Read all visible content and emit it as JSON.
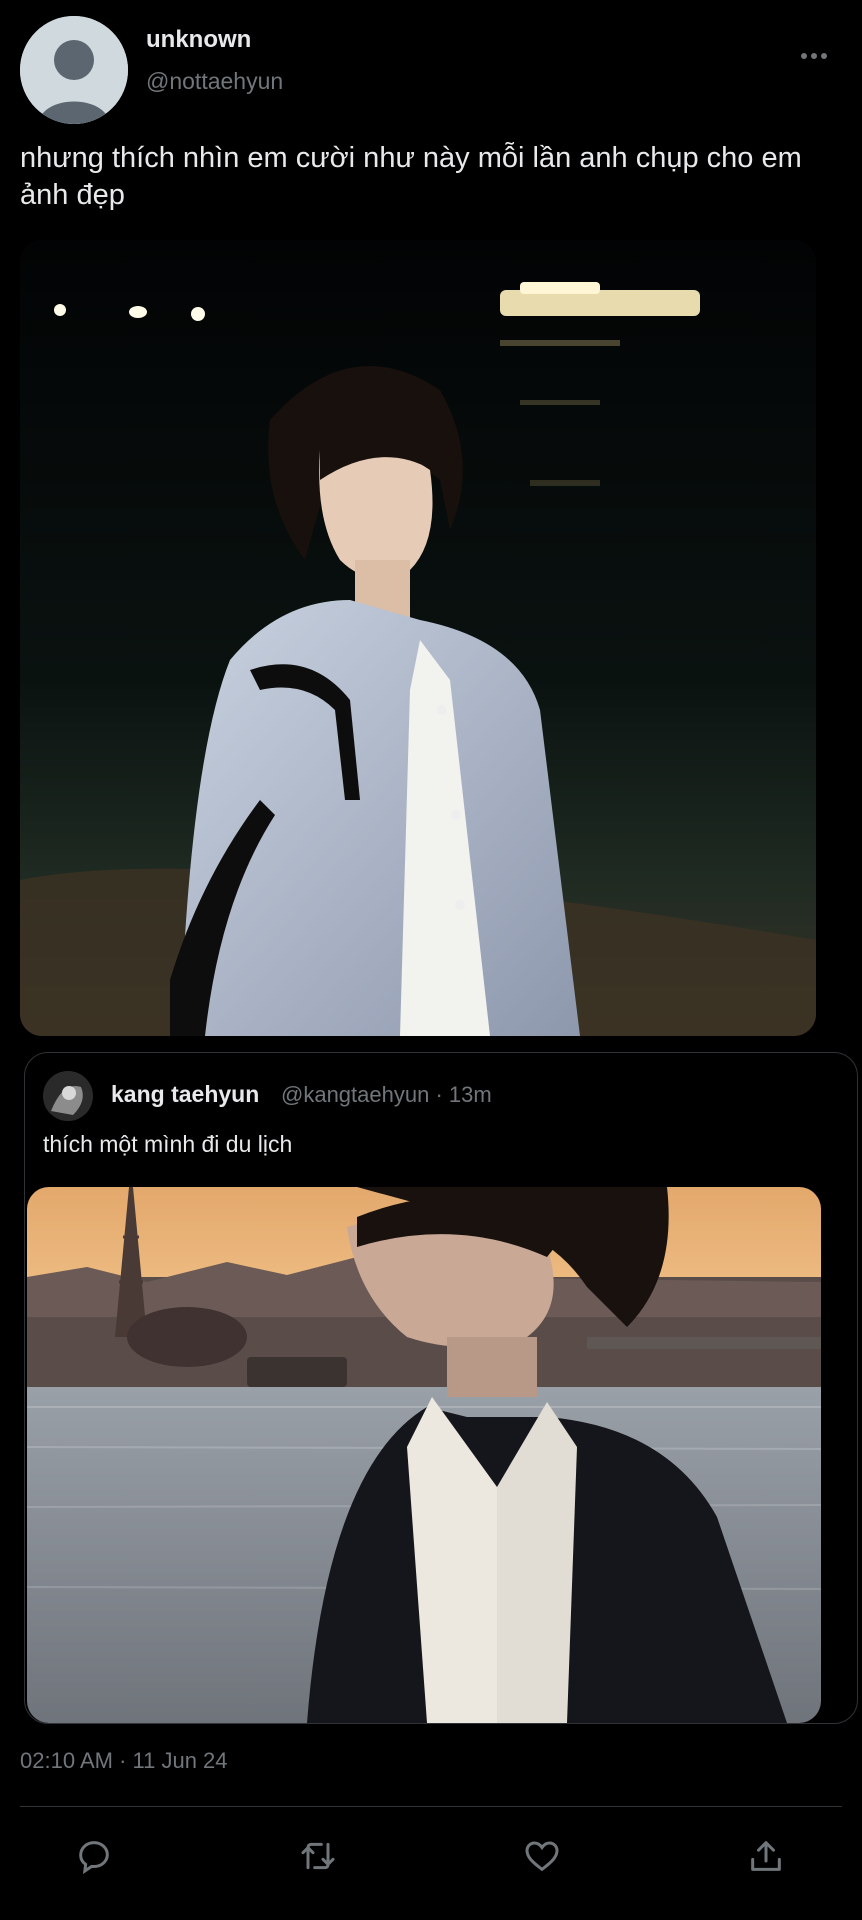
{
  "author": {
    "display_name": "unknown",
    "handle": "@nottaehyun",
    "avatar_icon": "default-avatar-icon"
  },
  "tweet": {
    "text": "nhưng thích nhìn em cười như này mỗi lần anh chụp cho em ảnh đẹp",
    "timestamp": "02:10 AM · 11 Jun 24",
    "more_icon": "more-dots-icon"
  },
  "quoted_tweet": {
    "display_name": "kang taehyun",
    "meta": "@kangtaehyun · 13m",
    "text": "thích một mình đi du lịch"
  },
  "actions": [
    {
      "icon": "reply-icon"
    },
    {
      "icon": "retweet-icon"
    },
    {
      "icon": "like-icon"
    },
    {
      "icon": "share-icon"
    }
  ],
  "colors": {
    "background": "#000000",
    "text_primary": "#e7e9ea",
    "text_secondary": "#71767b",
    "border": "#2f3336"
  }
}
